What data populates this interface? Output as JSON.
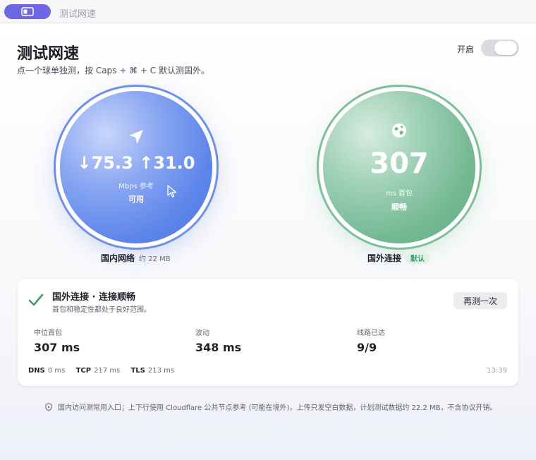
{
  "window": {
    "title": "测试网速"
  },
  "header": {
    "title": "测试网速",
    "subtitle": "点一个球单独测，按 Caps + ⌘ + C 默认测国外。",
    "toggle_label": "开启",
    "toggle_on": true
  },
  "domestic": {
    "speed": "↓75.3 ↑31.0",
    "unit": "Mbps 参考",
    "status": "可用",
    "caption": "国内网络",
    "caption_sub": "约 22 MB",
    "icon": "navigation-arrow-icon"
  },
  "overseas": {
    "latency": "307",
    "unit": "ms 首包",
    "status": "顺畅",
    "caption": "国外连接",
    "badge": "默认",
    "icon": "globe-icon"
  },
  "result_card": {
    "title": "国外连接 · 连接顺畅",
    "description": "首包和稳定性都处于良好范围。",
    "retest_label": "再测一次",
    "metrics": [
      {
        "label": "中位首包",
        "value": "307 ms"
      },
      {
        "label": "波动",
        "value": "348 ms"
      },
      {
        "label": "线路已达",
        "value": "9/9"
      }
    ],
    "timings": [
      {
        "name": "DNS",
        "value": "0 ms"
      },
      {
        "name": "TCP",
        "value": "217 ms"
      },
      {
        "name": "TLS",
        "value": "213 ms"
      }
    ],
    "timestamp": "13:39"
  },
  "footer": {
    "note": "国内访问测常用入口；上下行使用 Cloudflare 公共节点参考 (可能在境外)，上传只发空白数据，计划测试数据约 22.2 MB，不含协议开销。"
  },
  "colors": {
    "accent": "#6f66e6",
    "domestic_ball": "#5d85ea",
    "overseas_ball": "#72b892",
    "success_check": "#3e9a6a"
  }
}
